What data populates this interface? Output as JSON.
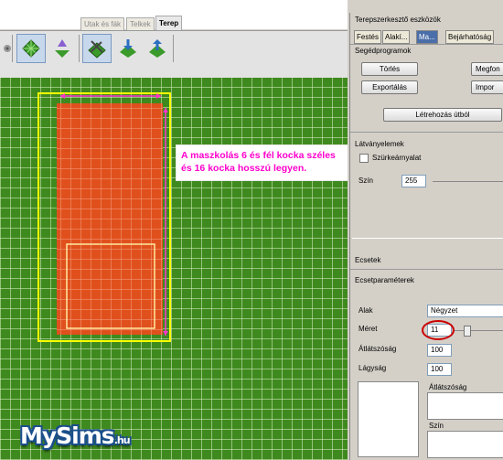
{
  "top_tabs": [
    "Utak és fák",
    "Telkek",
    "Terep"
  ],
  "toolbar": {
    "tools": [
      "paint-icon",
      "terrain-grid-icon",
      "flatten-icon",
      "smooth-icon",
      "level-terrain-icon",
      "raise-terrain-icon"
    ]
  },
  "annotation": {
    "text_line1": "A maszkolás 6 és fél kocka széles",
    "text_line2": "és 16 kocka hosszú legyen."
  },
  "panel": {
    "title": "Terepszerkesztő eszközök",
    "tabs": [
      "Festés",
      "Alakí...",
      "Ma...",
      "Bejárhatóság"
    ],
    "helpers": {
      "title": "Segédprogramok",
      "delete": "Törlés",
      "open": "Megfon",
      "export": "Exportálás",
      "import": "Impor",
      "create_from": "Létrehozás útból"
    },
    "visual": {
      "title": "Látványelemek",
      "greyscale": "Szürkeárnyalat",
      "color_label": "Szín",
      "color_value": "255"
    },
    "brushes": {
      "title": "Ecsetek"
    },
    "brush_params": {
      "title": "Ecsetparaméterek",
      "shape_label": "Alak",
      "shape_value": "Négyzet",
      "size_label": "Méret",
      "size_value": "11",
      "opacity_label": "Átlátszóság",
      "opacity_value": "100",
      "softness_label": "Lágyság",
      "softness_value": "100",
      "opacity2_label": "Átlátszóság",
      "color2_label": "Szín"
    }
  },
  "logo": {
    "text": "MySims",
    "suffix": ".hu"
  },
  "colors": {
    "grass": "#3f8a1e",
    "mask": "#e0501c",
    "highlight": "#ffff00",
    "arrow": "#ff33cc",
    "annotation_text": "#ff00cc",
    "circle": "#cc0000"
  }
}
